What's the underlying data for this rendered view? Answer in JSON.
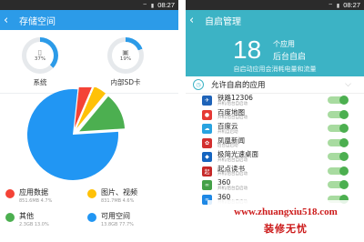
{
  "left": {
    "status": {
      "time": "08:27",
      "icons": "wifi signal battery"
    },
    "title": "存储空间",
    "system_card": {
      "percent": "37%",
      "label": "系统",
      "used_fraction": 0.37
    },
    "sd_card": {
      "percent": "19%",
      "label": "内部SD卡",
      "used_fraction": 0.19
    },
    "legend": [
      {
        "name": "应用数据",
        "value": "851.6MB 4.7%",
        "color": "#f44336"
      },
      {
        "name": "图片、视频",
        "value": "831.7MB 4.6%",
        "color": "#ffc107"
      },
      {
        "name": "其他",
        "value": "2.3GB 13.0%",
        "color": "#4caf50"
      },
      {
        "name": "可用空间",
        "value": "13.8GB 77.7%",
        "color": "#2196f3"
      }
    ]
  },
  "right": {
    "status": {
      "time": "08:27",
      "icons": "wifi signal battery"
    },
    "title": "自启管理",
    "count": "18",
    "count_unit": "个应用",
    "count_desc": "后台自启",
    "subtitle": "自启动应用会消耗电量和流量",
    "section_title": "允许自启的应用",
    "apps": [
      {
        "name": "铁路12306",
        "desc": "开机/后台自启动",
        "color": "#1e63b8",
        "icon": "train-icon",
        "glyph": "✈",
        "enabled": true
      },
      {
        "name": "百度地图",
        "desc": "开机/后台自启动",
        "color": "#e53935",
        "icon": "map-pin-icon",
        "glyph": "●",
        "enabled": true
      },
      {
        "name": "百度云",
        "desc": "开机自启动",
        "color": "#29a3e0",
        "icon": "cloud-icon",
        "glyph": "☁",
        "enabled": true
      },
      {
        "name": "凤凰新闻",
        "desc": "后台自启动",
        "color": "#d32f2f",
        "icon": "phoenix-icon",
        "glyph": "✿",
        "enabled": true
      },
      {
        "name": "极简光速桌面",
        "desc": "开机/后台自启动",
        "color": "#1565c0",
        "icon": "launcher-icon",
        "glyph": "◆",
        "enabled": true
      },
      {
        "name": "起点读书",
        "desc": "开机/后台自启动",
        "color": "#c62828",
        "icon": "book-icon",
        "glyph": "起",
        "enabled": true
      },
      {
        "name": "360",
        "desc": "开机/后台自启动",
        "color": "#43a047",
        "icon": "shield-icon",
        "glyph": "∞",
        "enabled": true
      },
      {
        "name": "360",
        "desc": "开机/后台自启动",
        "color": "#1e88e5",
        "icon": "security-icon",
        "glyph": "∞",
        "enabled": true
      }
    ]
  },
  "watermark": {
    "url": "www.zhuangxiu518.com",
    "brand": "装修无忧"
  }
}
